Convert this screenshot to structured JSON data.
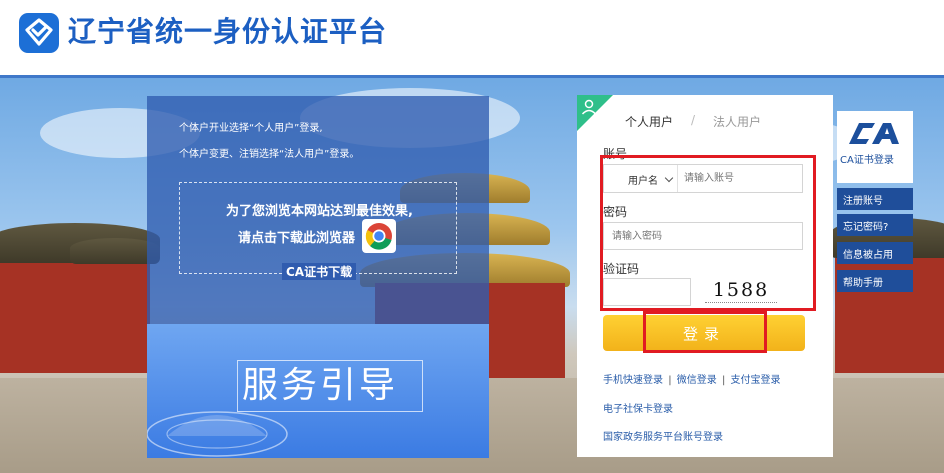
{
  "header": {
    "title": "辽宁省统一身份认证平台",
    "logo_icon": "shield-check-icon",
    "accent": "#1c5fc2"
  },
  "guide": {
    "note_line1": "个体户开业选择“个人用户”登录,",
    "note_line2": "个体户变更、注销选择“法人用户”登录。",
    "browser_line1": "为了您浏览本网站达到最佳效果,",
    "browser_line2": "请点击下载此浏览器",
    "browser_icon": "chrome-icon",
    "ca_download": "CA证书下载",
    "service_guide": "服务引导"
  },
  "login": {
    "tab_personal": "个人用户",
    "tab_separator": "/",
    "tab_legal": "法人用户",
    "account_label": "账号",
    "account_type": "用户名",
    "account_placeholder": "请输入账号",
    "password_label": "密码",
    "password_placeholder": "请输入密码",
    "captcha_label": "验证码",
    "captcha_value": "1588",
    "submit_label": "登录",
    "alt_mobile": "手机快速登录",
    "alt_wechat": "微信登录",
    "alt_alipay": "支付宝登录",
    "alt_sep": "|",
    "social_card": "电子社保卡登录",
    "national_platform": "国家政务服务平台账号登录",
    "button_color": "#f7c21f",
    "highlight_color": "#e11b22"
  },
  "sidebar": {
    "ca_icon": "ca-logo-icon",
    "ca_label": "CA证书登录",
    "items": [
      {
        "label": "注册账号"
      },
      {
        "label": "忘记密码?"
      },
      {
        "label": "信息被占用"
      },
      {
        "label": "帮助手册"
      }
    ]
  }
}
